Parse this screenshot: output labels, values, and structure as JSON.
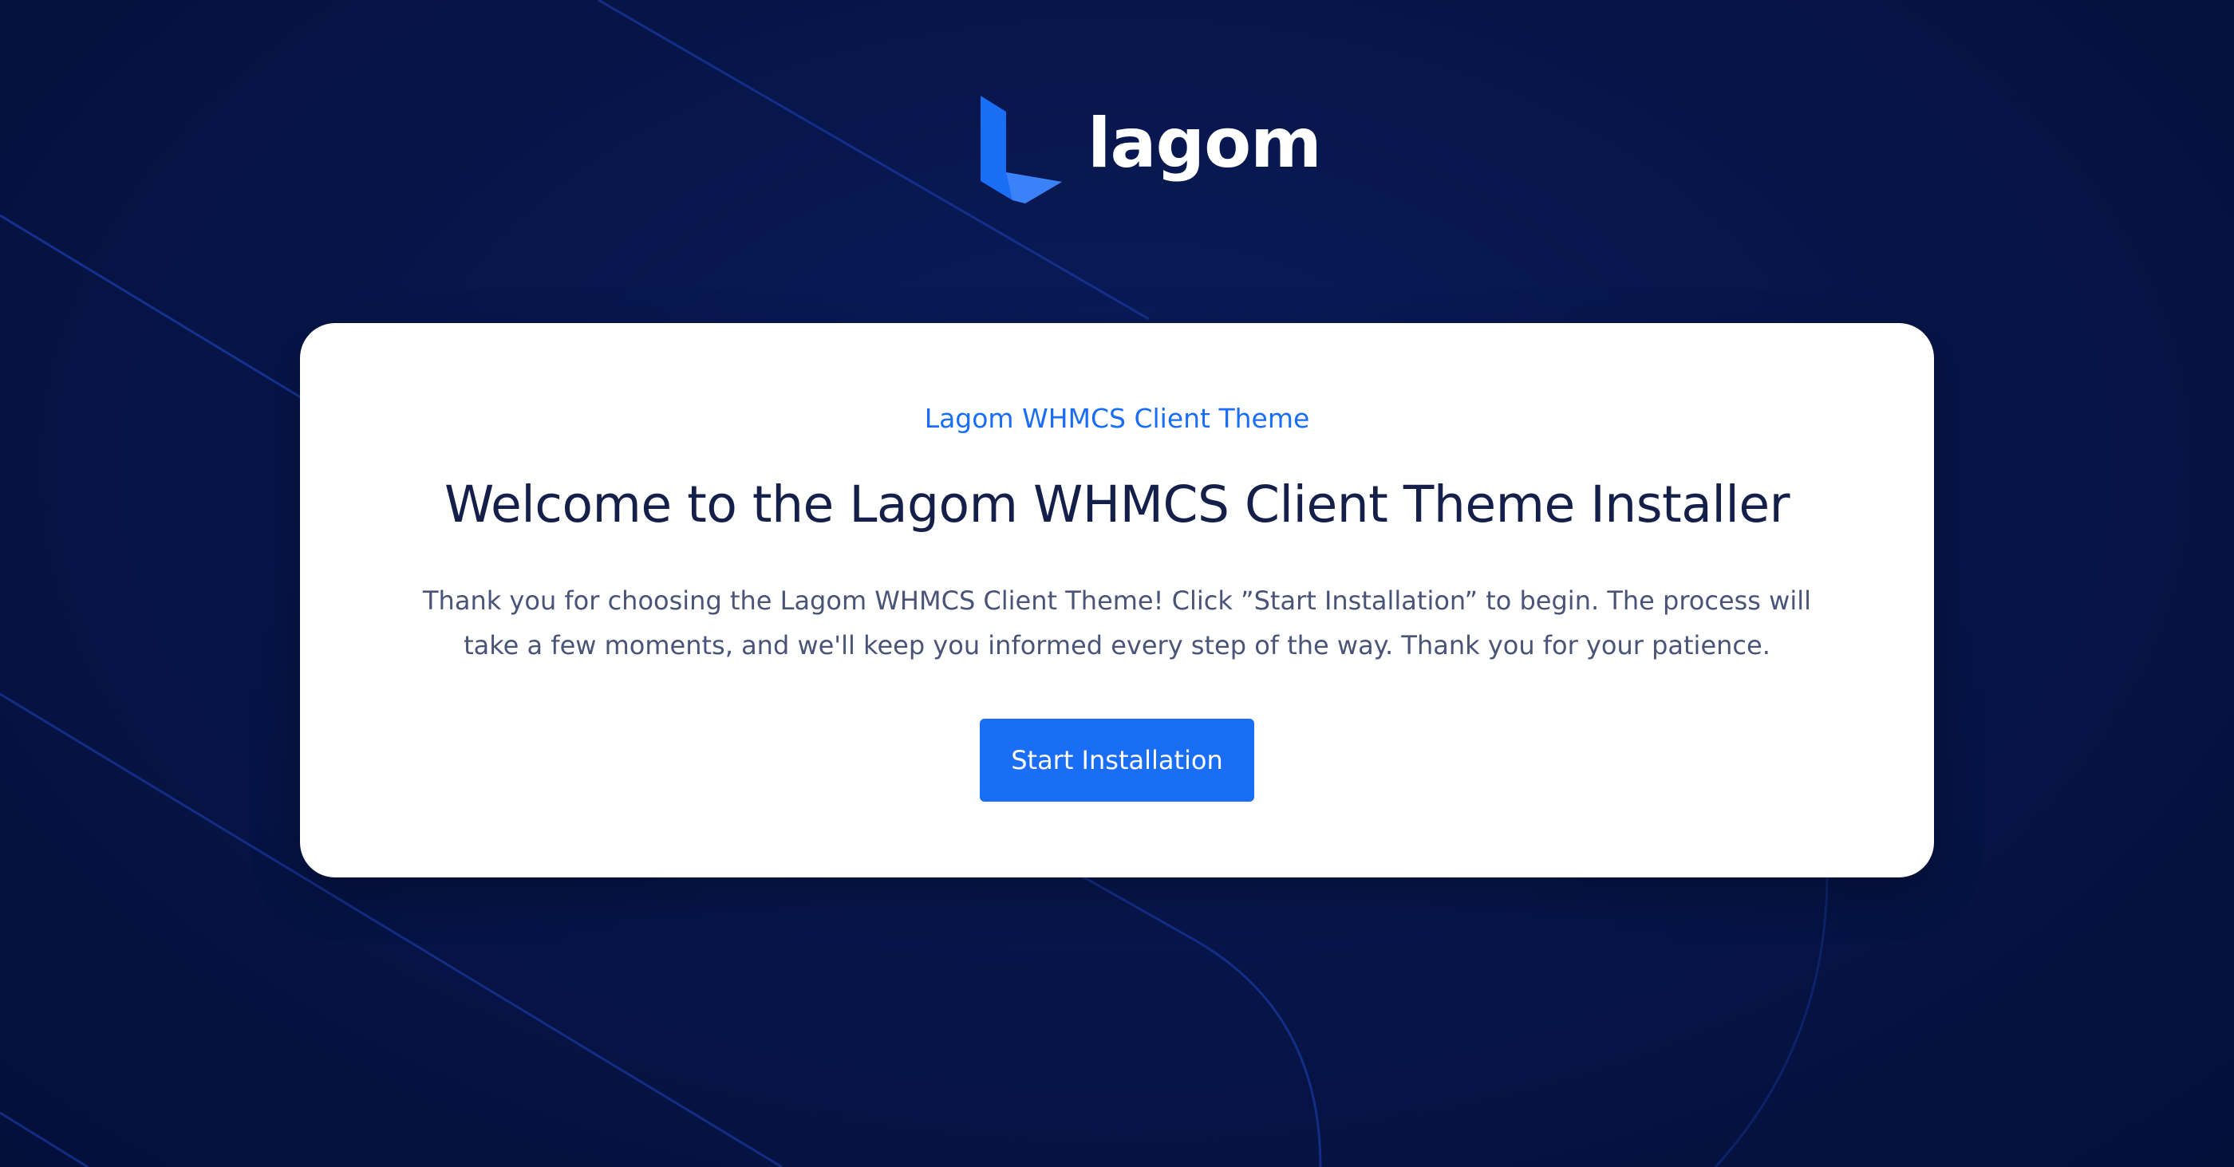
{
  "brand": {
    "name": "lagom",
    "logo_icon": "lagom-logo-icon",
    "accent_color": "#1a6ef5"
  },
  "card": {
    "eyebrow": "Lagom WHMCS Client Theme",
    "title": "Welcome to the Lagom WHMCS Client Theme Installer",
    "description": "Thank you for choosing the Lagom WHMCS Client Theme! Click ”Start Installation” to begin. The process will take a few moments, and we'll keep you informed every step of the way. Thank you for your patience.",
    "button_label": "Start Installation"
  },
  "colors": {
    "background": "#061447",
    "card_background": "#ffffff",
    "title": "#14204a",
    "body_text": "#4a5378",
    "decorative_lines": "#1d3fb0"
  }
}
